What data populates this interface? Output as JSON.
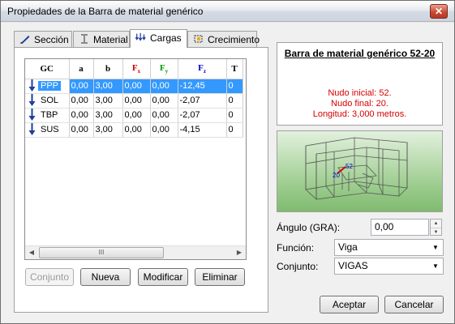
{
  "window": {
    "title": "Propiedades de la Barra de material genérico",
    "close_glyph": "✕"
  },
  "tabs": [
    {
      "label": "Sección",
      "icon": "pencil-icon"
    },
    {
      "label": "Material",
      "icon": "beam-icon"
    },
    {
      "label": "Cargas",
      "icon": "loads-icon",
      "active": true
    },
    {
      "label": "Crecimiento",
      "icon": "growth-icon"
    }
  ],
  "grid": {
    "headers": [
      "GC",
      "a",
      "b",
      "Fx",
      "Fy",
      "Fz",
      "T"
    ],
    "header_colors": {
      "Fx": "#cc0000",
      "Fy": "#009900",
      "Fz": "#0000cc"
    },
    "rows": [
      {
        "gc": "PPP",
        "a": "0,00",
        "b": "3,00",
        "fx": "0,00",
        "fy": "0,00",
        "fz": "-12,45",
        "t": "0",
        "selected": true
      },
      {
        "gc": "SOL",
        "a": "0,00",
        "b": "3,00",
        "fx": "0,00",
        "fy": "0,00",
        "fz": "-2,07",
        "t": "0"
      },
      {
        "gc": "TBP",
        "a": "0,00",
        "b": "3,00",
        "fx": "0,00",
        "fy": "0,00",
        "fz": "-2,07",
        "t": "0"
      },
      {
        "gc": "SUS",
        "a": "0,00",
        "b": "3,00",
        "fx": "0,00",
        "fy": "0,00",
        "fz": "-4,15",
        "t": "0"
      }
    ],
    "scroll_grip": "III"
  },
  "buttons": {
    "conjunto": "Conjunto",
    "nueva": "Nueva",
    "modificar": "Modificar",
    "eliminar": "Eliminar",
    "aceptar": "Aceptar",
    "cancelar": "Cancelar"
  },
  "info": {
    "title": "Barra de material genérico 52-20",
    "nudo_inicial": "Nudo inicial: 52.",
    "nudo_final": "Nudo final: 20.",
    "longitud": "Longitud: 3,000 metros."
  },
  "view3d": {
    "label_start": "52",
    "label_end": "20"
  },
  "form": {
    "angulo_label": "Ángulo (GRA):",
    "angulo_value": "0,00",
    "funcion_label": "Función:",
    "funcion_value": "Viga",
    "conjunto_label": "Conjunto:",
    "conjunto_value": "VIGAS"
  }
}
